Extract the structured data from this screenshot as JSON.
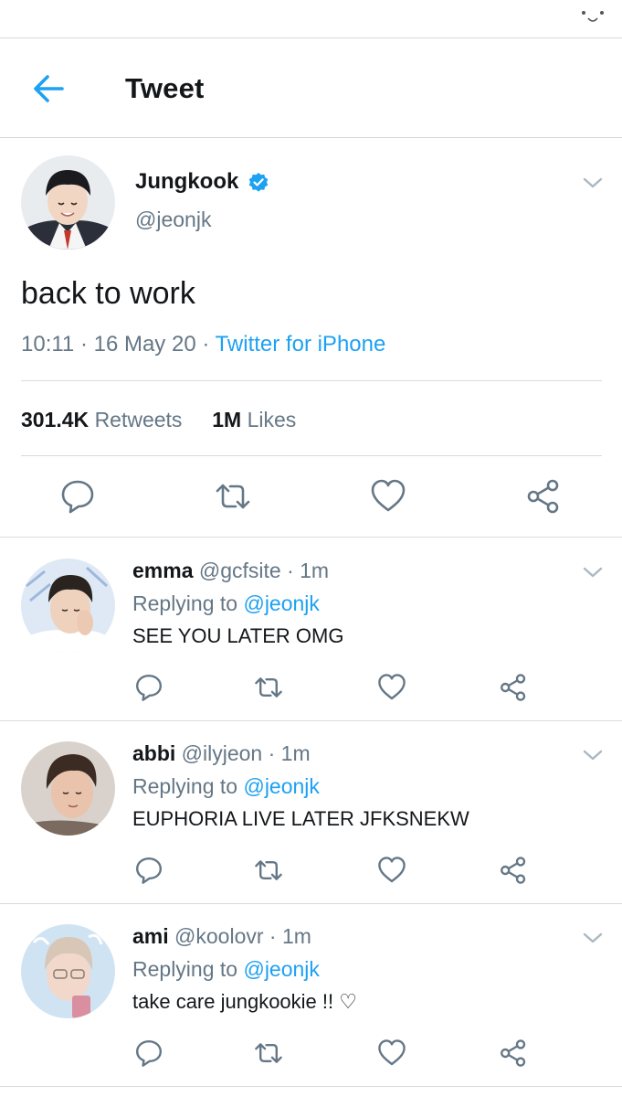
{
  "header": {
    "title": "Tweet"
  },
  "tweet": {
    "author": {
      "name": "Jungkook",
      "handle": "@jeonjk"
    },
    "text": "back to work",
    "time": "10:11 · 16 May 20 ·",
    "source": "Twitter for iPhone",
    "retweets_count": "301.4K",
    "retweets_label": "Retweets",
    "likes_count": "1M",
    "likes_label": "Likes"
  },
  "replies": [
    {
      "name": "emma",
      "meta": "@gcfsite · 1m",
      "replying_label": "Replying to",
      "mention": "@jeonjk",
      "text": "SEE YOU LATER OMG"
    },
    {
      "name": "abbi",
      "meta": "@ilyjeon · 1m",
      "replying_label": "Replying to",
      "mention": "@jeonjk",
      "text": "EUPHORIA LIVE LATER JFKSNEKW"
    },
    {
      "name": "ami",
      "meta": "@koolovr · 1m",
      "replying_label": "Replying to",
      "mention": "@jeonjk",
      "text": "take care jungkookie !! ♡"
    }
  ],
  "colors": {
    "accent": "#1da1f2",
    "muted": "#657786",
    "text": "#14171a",
    "icon": "#657786"
  },
  "icons": {
    "back": "arrow-left-icon",
    "verified": "verified-badge-icon",
    "menu": "chevron-down-icon",
    "reply": "reply-icon",
    "retweet": "retweet-icon",
    "like": "heart-icon",
    "share": "share-icon"
  }
}
